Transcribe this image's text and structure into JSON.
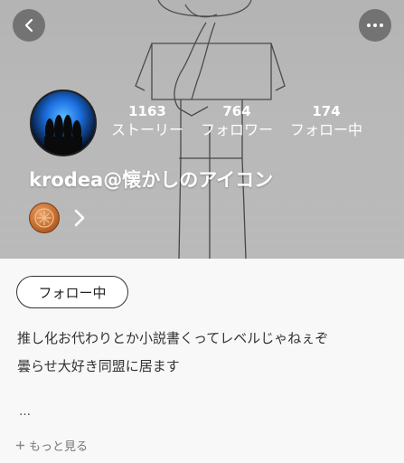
{
  "profile": {
    "username": "krodea@懐かしのアイコン",
    "stats": [
      {
        "value": "1163",
        "label": "ストーリー"
      },
      {
        "value": "764",
        "label": "フォロワー"
      },
      {
        "value": "174",
        "label": "フォロー中"
      }
    ],
    "follow_button_label": "フォロー中",
    "bio_lines": [
      "推し化お代わりとか小説書くってレベルじゃねぇぞ",
      "曇らせ大好き同盟に居ます"
    ],
    "ellipsis": "…",
    "see_more_label": "もっと見る"
  },
  "icons": {
    "back": "chevron-left-icon",
    "more": "more-horizontal-icon",
    "badge": "coin-badge-icon",
    "badge_arrow": "chevron-right-icon",
    "see_more": "plus-icon"
  },
  "colors": {
    "header_bg": "#c8c8c8",
    "content_bg": "#f8f8f8",
    "text": "#333333"
  }
}
